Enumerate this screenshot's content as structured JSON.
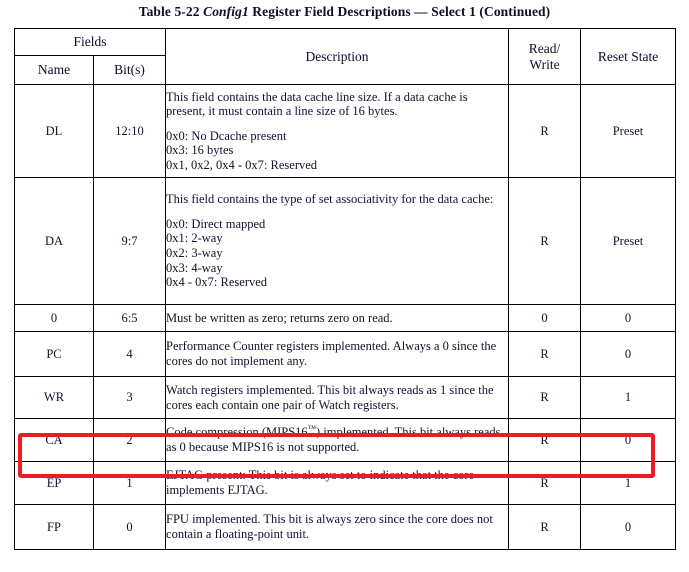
{
  "caption": {
    "prefix": "Table 5-22 ",
    "italic": "Config1",
    "suffix": " Register Field Descriptions — Select 1 (Continued)"
  },
  "table": {
    "group_header": "Fields",
    "columns": {
      "name": "Name",
      "bits": "Bit(s)",
      "description": "Description",
      "read_write_line1": "Read/",
      "read_write_line2": "Write",
      "reset_state": "Reset State"
    },
    "rows": [
      {
        "name": "DL",
        "bits": "12:10",
        "desc_para": "This field contains the data cache line size. If a data cache is present, it must contain a line size of 16 bytes.",
        "desc_list": [
          "0x0: No Dcache present",
          "0x3: 16 bytes",
          "0x1, 0x2, 0x4 - 0x7: Reserved"
        ],
        "rw": "R",
        "reset": "Preset"
      },
      {
        "name": "DA",
        "bits": "9:7",
        "desc_para": "This field contains the type of set associativity for the data cache:",
        "desc_list": [
          "0x0: Direct mapped",
          "0x1: 2-way",
          "0x2: 3-way",
          "0x3: 4-way",
          "0x4 - 0x7: Reserved"
        ],
        "rw": "R",
        "reset": "Preset"
      },
      {
        "name": "0",
        "bits": "6:5",
        "desc_para": "Must be written as zero; returns zero on read.",
        "desc_list": [],
        "rw": "0",
        "reset": "0"
      },
      {
        "name": "PC",
        "bits": "4",
        "desc_para": "Performance Counter registers implemented. Always a 0 since the cores do not implement any.",
        "desc_list": [],
        "rw": "R",
        "reset": "0"
      },
      {
        "name": "WR",
        "bits": "3",
        "desc_para": "Watch registers implemented. This bit always reads as 1 since the cores each contain one pair of Watch registers.",
        "desc_list": [],
        "rw": "R",
        "reset": "1"
      },
      {
        "name": "CA",
        "bits": "2",
        "desc_para_pre": "Code compression (MIPS16",
        "desc_tm": "™",
        "desc_para_post": ") implemented. This bit always reads as 0 because MIPS16 is not supported.",
        "desc_list": [],
        "rw": "R",
        "reset": "0",
        "highlighted": true
      },
      {
        "name": "EP",
        "bits": "1",
        "desc_para": "EJTAG present: This bit is always set to indicate that the core implements EJTAG.",
        "desc_list": [],
        "rw": "R",
        "reset": "1"
      },
      {
        "name": "FP",
        "bits": "0",
        "desc_para": "FPU implemented. This bit is always zero since the core does not contain a floating-point unit.",
        "desc_list": [],
        "rw": "R",
        "reset": "0"
      }
    ]
  },
  "annotation": {
    "highlight_color": "#ee1b24",
    "highlight_target_row": "CA"
  }
}
